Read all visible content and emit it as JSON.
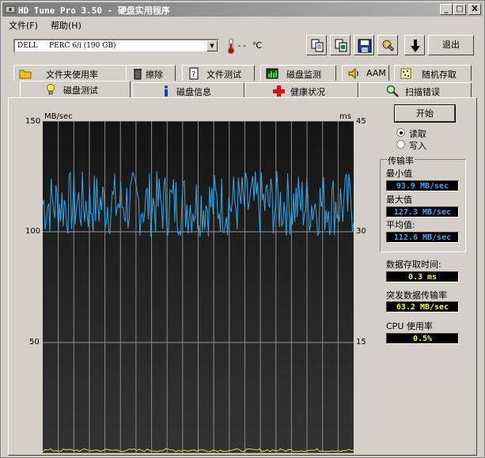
{
  "window": {
    "title": "HD Tune Pro 3.50 - 硬盘实用程序",
    "controls": {
      "minimize": "_",
      "maximize": "□",
      "close": "X"
    }
  },
  "menu": {
    "file": "文件(F)",
    "help": "帮助(H)"
  },
  "toolbar": {
    "drive": "DELL     PERC 6/i (190 GB)",
    "temperature": "-- ℃",
    "exit_label": "退出"
  },
  "tabs_row1": [
    {
      "label": "文件夹使用率",
      "icon": "folder-icon"
    },
    {
      "label": "擦除",
      "icon": "trash-icon"
    },
    {
      "label": "文件测试",
      "icon": "file-test-icon"
    },
    {
      "label": "磁盘监测",
      "icon": "monitor-chart-icon"
    },
    {
      "label": "AAM",
      "icon": "speaker-icon"
    },
    {
      "label": "随机存取",
      "icon": "random-access-icon"
    }
  ],
  "tabs_row2": [
    {
      "label": "磁盘测试",
      "icon": "lightbulb-icon",
      "active": true
    },
    {
      "label": "磁盘信息",
      "icon": "info-icon"
    },
    {
      "label": "健康状况",
      "icon": "health-cross-icon"
    },
    {
      "label": "扫描错误",
      "icon": "magnifier-icon"
    }
  ],
  "chart_data": {
    "type": "line",
    "y_left_label": "MB/sec",
    "y_right_label": "ms",
    "y_left_ticks": [
      "150",
      "100",
      "50"
    ],
    "y_right_ticks": [
      "45",
      "30",
      "15"
    ],
    "ylim_left": [
      0,
      150
    ],
    "ylim_right": [
      0,
      45
    ],
    "grid": true,
    "series": [
      {
        "color": "#2fa6e6",
        "min": 93.9,
        "max": 127.3,
        "avg": 112.6
      },
      {
        "color": "#e8e800",
        "avg": 0.3
      }
    ]
  },
  "controls": {
    "start_label": "开始",
    "read_label": "读取",
    "write_label": "写入",
    "mode": "read"
  },
  "stats": {
    "transfer_rate_title": "传输率",
    "min_label": "最小值",
    "min_value": "93.9 MB/sec",
    "max_label": "最大值",
    "max_value": "127.3 MB/sec",
    "avg_label": "平均值:",
    "avg_value": "112.6 MB/sec",
    "access_time_label": "数据存取时间:",
    "access_time_value": "0.3 ms",
    "burst_rate_label": "突发数据传输率",
    "burst_rate_value": "63.2 MB/sec",
    "cpu_label": "CPU 使用率",
    "cpu_value": "0.5%"
  },
  "colors": {
    "plot_background": "#1e1e1e",
    "read_series": "#2fa6e6",
    "access_series": "#e8e800",
    "lcd_blue": "#3fa7ff",
    "lcd_yellow": "#f4ff3d"
  }
}
